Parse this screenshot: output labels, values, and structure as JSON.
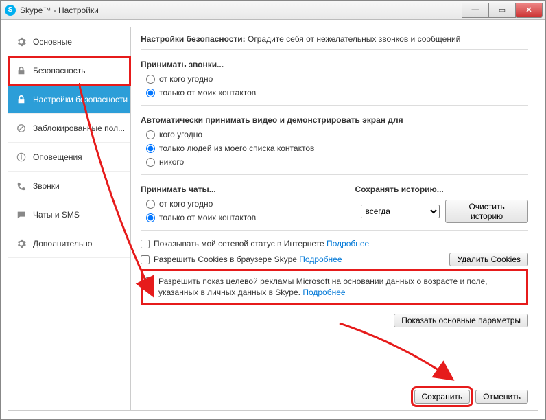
{
  "window": {
    "title": "Skype™ - Настройки"
  },
  "winbtns": {
    "min": "—",
    "max": "▭",
    "close": "✕"
  },
  "sidebar": {
    "items": [
      {
        "label": "Основные"
      },
      {
        "label": "Безопасность"
      },
      {
        "label": "Настройки безопасности"
      },
      {
        "label": "Заблокированные пол..."
      },
      {
        "label": "Оповещения"
      },
      {
        "label": "Звонки"
      },
      {
        "label": "Чаты и SMS"
      },
      {
        "label": "Дополнительно"
      }
    ]
  },
  "header": {
    "title": "Настройки безопасности:",
    "subtitle": "Оградите себя от нежелательных звонков и сообщений"
  },
  "calls": {
    "title": "Принимать звонки...",
    "opt_anyone": "от кого угодно",
    "opt_contacts": "только от моих контактов"
  },
  "video": {
    "title": "Автоматически принимать видео и демонстрировать экран для",
    "opt_anyone": "кого угодно",
    "opt_contacts": "только людей из моего списка контактов",
    "opt_noone": "никого"
  },
  "chats": {
    "title": "Принимать чаты...",
    "opt_anyone": "от кого угодно",
    "opt_contacts": "только от моих контактов"
  },
  "history": {
    "title": "Сохранять историю...",
    "selected": "всегда",
    "clear_btn": "Очистить историю"
  },
  "checks": {
    "status_text": "Показывать мой сетевой статус в Интернете ",
    "cookies_text": "Разрешить Cookies в браузере Skype ",
    "targeted_text": "Разрешить показ целевой рекламы Microsoft на основании данных о возрасте и поле, указанных в личных данных в Skype. ",
    "more": "Подробнее"
  },
  "buttons": {
    "delete_cookies": "Удалить Cookies",
    "show_basic": "Показать основные параметры",
    "save": "Сохранить",
    "cancel": "Отменить"
  }
}
